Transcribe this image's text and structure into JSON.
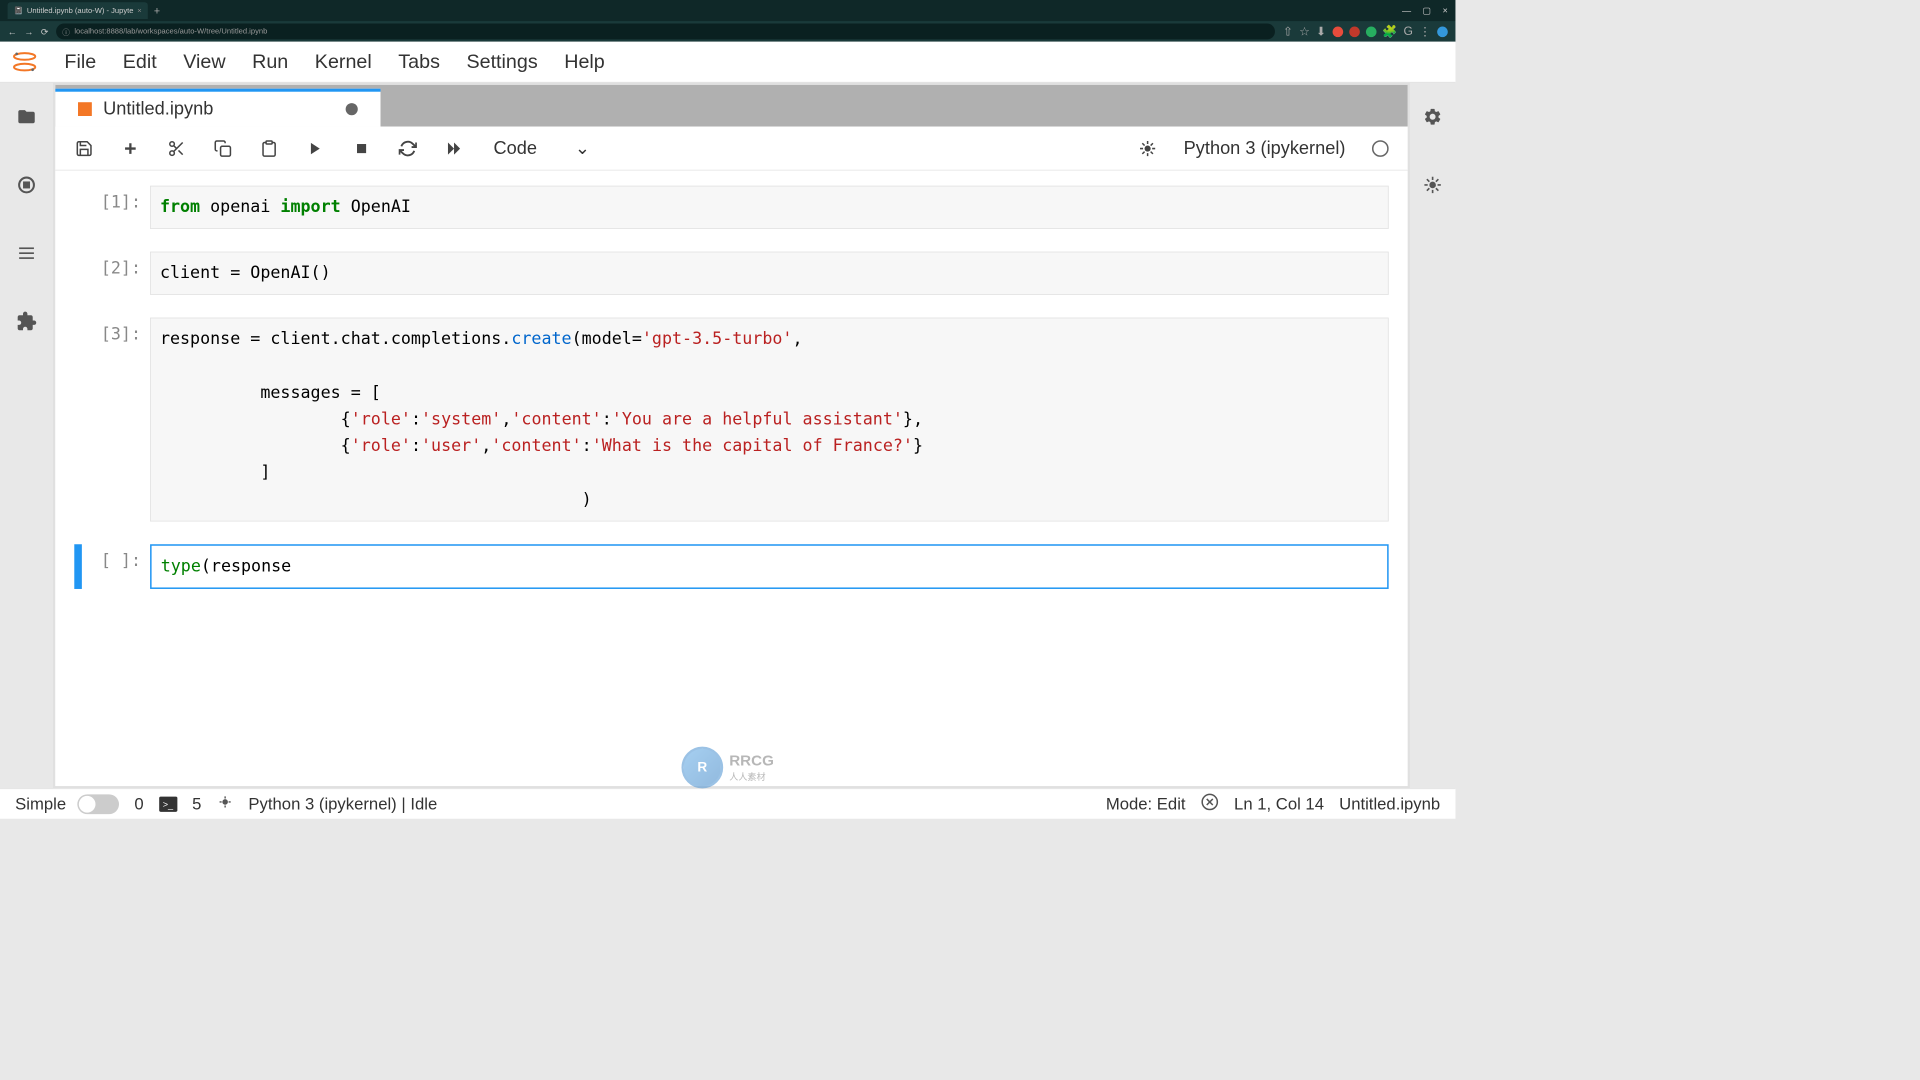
{
  "browser": {
    "tab_title": "Untitled.ipynb (auto-W) - Jupyte",
    "url": "localhost:8888/lab/workspaces/auto-W/tree/Untitled.ipynb"
  },
  "menubar": {
    "items": [
      "File",
      "Edit",
      "View",
      "Run",
      "Kernel",
      "Tabs",
      "Settings",
      "Help"
    ]
  },
  "file_tab": {
    "name": "Untitled.ipynb"
  },
  "toolbar": {
    "cell_type": "Code",
    "kernel_label": "Python 3 (ipykernel)"
  },
  "cells": [
    {
      "prompt": "[1]:",
      "tokens": [
        {
          "t": "from",
          "c": "kw-green"
        },
        {
          "t": " openai "
        },
        {
          "t": "import",
          "c": "kw-import"
        },
        {
          "t": " OpenAI"
        }
      ]
    },
    {
      "prompt": "[2]:",
      "tokens": [
        {
          "t": "client = OpenAI()"
        }
      ]
    },
    {
      "prompt": "[3]:",
      "lines": [
        [
          {
            "t": "response = client.chat.completions."
          },
          {
            "t": "create",
            "c": "func-blue"
          },
          {
            "t": "(model="
          },
          {
            "t": "'gpt-3.5-turbo'",
            "c": "str-red"
          },
          {
            "t": ","
          }
        ],
        [
          {
            "t": ""
          }
        ],
        [
          {
            "t": "          messages = ["
          }
        ],
        [
          {
            "t": "                  {"
          },
          {
            "t": "'role'",
            "c": "str-red"
          },
          {
            "t": ":"
          },
          {
            "t": "'system'",
            "c": "str-red"
          },
          {
            "t": ","
          },
          {
            "t": "'content'",
            "c": "str-red"
          },
          {
            "t": ":"
          },
          {
            "t": "'You are a helpful assistant'",
            "c": "str-red"
          },
          {
            "t": "},"
          }
        ],
        [
          {
            "t": "                  {"
          },
          {
            "t": "'role'",
            "c": "str-red"
          },
          {
            "t": ":"
          },
          {
            "t": "'user'",
            "c": "str-red"
          },
          {
            "t": ","
          },
          {
            "t": "'content'",
            "c": "str-red"
          },
          {
            "t": ":"
          },
          {
            "t": "'What is the capital of France?'",
            "c": "str-red"
          },
          {
            "t": "}"
          }
        ],
        [
          {
            "t": "          ]"
          }
        ],
        [
          {
            "t": "                                          )"
          }
        ]
      ]
    },
    {
      "prompt": "[ ]:",
      "active": true,
      "tokens": [
        {
          "t": "type",
          "c": "builtin"
        },
        {
          "t": "(response"
        }
      ]
    }
  ],
  "statusbar": {
    "simple": "Simple",
    "num1": "0",
    "num2": "5",
    "kernel_status": "Python 3 (ipykernel) | Idle",
    "mode": "Mode: Edit",
    "position": "Ln 1, Col 14",
    "filename": "Untitled.ipynb"
  },
  "watermark": {
    "text": "RRCG",
    "subtext": "人人素材"
  }
}
